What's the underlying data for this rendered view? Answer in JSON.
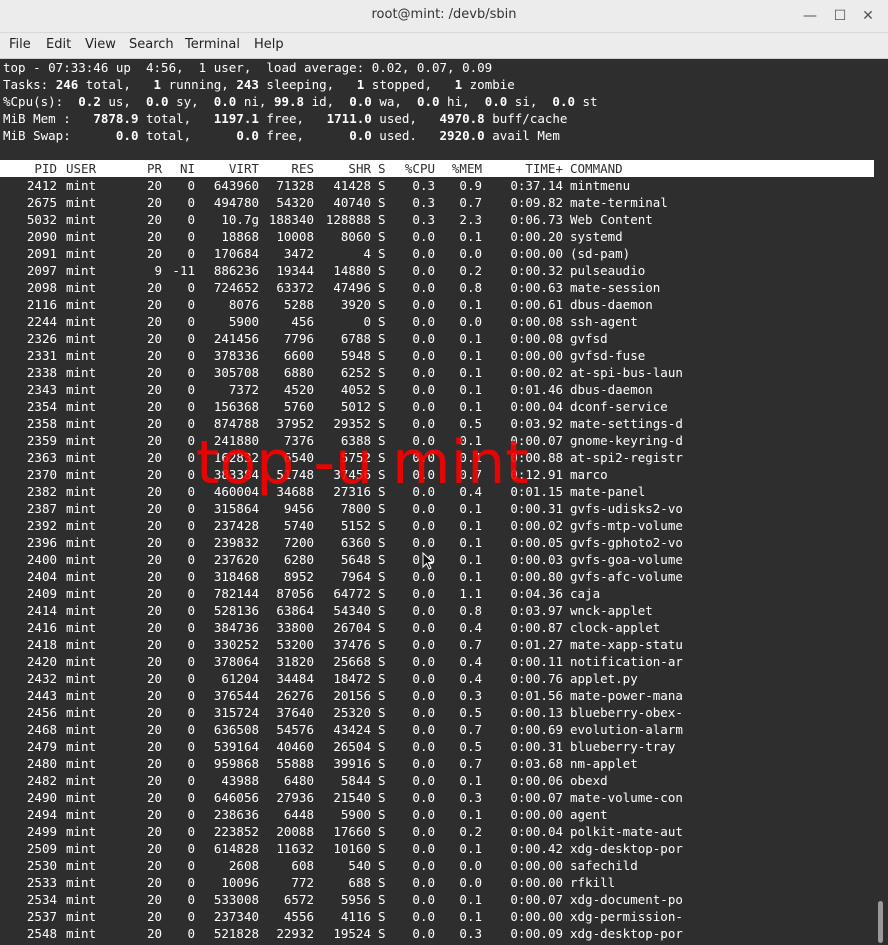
{
  "window": {
    "title": "root@mint: /devb/sbin"
  },
  "menu": [
    "File",
    "Edit",
    "View",
    "Search",
    "Terminal",
    "Help"
  ],
  "top_lines": [
    "top - 07:33:46 up  4:56,  1 user,  load average: 0.02, 0.07, 0.09",
    [
      [
        "Tasks: ",
        false
      ],
      [
        "246",
        true
      ],
      [
        " total,   ",
        false
      ],
      [
        "1",
        true
      ],
      [
        " running, ",
        false
      ],
      [
        "243",
        true
      ],
      [
        " sleeping,   ",
        false
      ],
      [
        "1",
        true
      ],
      [
        " stopped,   ",
        false
      ],
      [
        "1",
        true
      ],
      [
        " zombie",
        false
      ]
    ],
    [
      [
        "%Cpu(s):  ",
        false
      ],
      [
        "0.2",
        true
      ],
      [
        " us,  ",
        false
      ],
      [
        "0.0",
        true
      ],
      [
        " sy,  ",
        false
      ],
      [
        "0.0",
        true
      ],
      [
        " ni, ",
        false
      ],
      [
        "99.8",
        true
      ],
      [
        " id,  ",
        false
      ],
      [
        "0.0",
        true
      ],
      [
        " wa,  ",
        false
      ],
      [
        "0.0",
        true
      ],
      [
        " hi,  ",
        false
      ],
      [
        "0.0",
        true
      ],
      [
        " si,  ",
        false
      ],
      [
        "0.0",
        true
      ],
      [
        " st",
        false
      ]
    ],
    [
      [
        "MiB Mem :   ",
        false
      ],
      [
        "7878.9",
        true
      ],
      [
        " total,   ",
        false
      ],
      [
        "1197.1",
        true
      ],
      [
        " free,   ",
        false
      ],
      [
        "1711.0",
        true
      ],
      [
        " used,   ",
        false
      ],
      [
        "4970.8",
        true
      ],
      [
        " buff/cache",
        false
      ]
    ],
    [
      [
        "MiB Swap:      ",
        false
      ],
      [
        "0.0",
        true
      ],
      [
        " total,      ",
        false
      ],
      [
        "0.0",
        true
      ],
      [
        " free,      ",
        false
      ],
      [
        "0.0",
        true
      ],
      [
        " used.   ",
        false
      ],
      [
        "2920.0",
        true
      ],
      [
        " avail Mem",
        false
      ]
    ]
  ],
  "columns": [
    "PID",
    "USER",
    "PR",
    "NI",
    "VIRT",
    "RES",
    "SHR",
    "S",
    "%CPU",
    "%MEM",
    "TIME+",
    "COMMAND"
  ],
  "processes": [
    [
      "2412",
      "mint",
      "20",
      "0",
      "643960",
      "71328",
      "41428",
      "S",
      "0.3",
      "0.9",
      "0:37.14",
      "mintmenu"
    ],
    [
      "2675",
      "mint",
      "20",
      "0",
      "494780",
      "54320",
      "40740",
      "S",
      "0.3",
      "0.7",
      "0:09.82",
      "mate-terminal"
    ],
    [
      "5032",
      "mint",
      "20",
      "0",
      "10.7g",
      "188340",
      "128888",
      "S",
      "0.3",
      "2.3",
      "0:06.73",
      "Web Content"
    ],
    [
      "2090",
      "mint",
      "20",
      "0",
      "18868",
      "10008",
      "8060",
      "S",
      "0.0",
      "0.1",
      "0:00.20",
      "systemd"
    ],
    [
      "2091",
      "mint",
      "20",
      "0",
      "170684",
      "3472",
      "4",
      "S",
      "0.0",
      "0.0",
      "0:00.00",
      "(sd-pam)"
    ],
    [
      "2097",
      "mint",
      "9",
      "-11",
      "886236",
      "19344",
      "14880",
      "S",
      "0.0",
      "0.2",
      "0:00.32",
      "pulseaudio"
    ],
    [
      "2098",
      "mint",
      "20",
      "0",
      "724652",
      "63372",
      "47496",
      "S",
      "0.0",
      "0.8",
      "0:00.63",
      "mate-session"
    ],
    [
      "2116",
      "mint",
      "20",
      "0",
      "8076",
      "5288",
      "3920",
      "S",
      "0.0",
      "0.1",
      "0:00.61",
      "dbus-daemon"
    ],
    [
      "2244",
      "mint",
      "20",
      "0",
      "5900",
      "456",
      "0",
      "S",
      "0.0",
      "0.0",
      "0:00.08",
      "ssh-agent"
    ],
    [
      "2326",
      "mint",
      "20",
      "0",
      "241456",
      "7796",
      "6788",
      "S",
      "0.0",
      "0.1",
      "0:00.08",
      "gvfsd"
    ],
    [
      "2331",
      "mint",
      "20",
      "0",
      "378336",
      "6600",
      "5948",
      "S",
      "0.0",
      "0.1",
      "0:00.00",
      "gvfsd-fuse"
    ],
    [
      "2338",
      "mint",
      "20",
      "0",
      "305708",
      "6880",
      "6252",
      "S",
      "0.0",
      "0.1",
      "0:00.02",
      "at-spi-bus-laun"
    ],
    [
      "2343",
      "mint",
      "20",
      "0",
      "7372",
      "4520",
      "4052",
      "S",
      "0.0",
      "0.1",
      "0:01.46",
      "dbus-daemon"
    ],
    [
      "2354",
      "mint",
      "20",
      "0",
      "156368",
      "5760",
      "5012",
      "S",
      "0.0",
      "0.1",
      "0:00.04",
      "dconf-service"
    ],
    [
      "2358",
      "mint",
      "20",
      "0",
      "874788",
      "37952",
      "29352",
      "S",
      "0.0",
      "0.5",
      "0:03.92",
      "mate-settings-d"
    ],
    [
      "2359",
      "mint",
      "20",
      "0",
      "241880",
      "7376",
      "6388",
      "S",
      "0.0",
      "0.1",
      "0:00.07",
      "gnome-keyring-d"
    ],
    [
      "2363",
      "mint",
      "20",
      "0",
      "162832",
      "6540",
      "5752",
      "S",
      "0.0",
      "0.1",
      "0:00.88",
      "at-spi2-registr"
    ],
    [
      "2370",
      "mint",
      "20",
      "0",
      "383384",
      "51748",
      "37456",
      "S",
      "0.0",
      "0.7",
      "0:12.91",
      "marco"
    ],
    [
      "2382",
      "mint",
      "20",
      "0",
      "460004",
      "34688",
      "27316",
      "S",
      "0.0",
      "0.4",
      "0:01.15",
      "mate-panel"
    ],
    [
      "2387",
      "mint",
      "20",
      "0",
      "315864",
      "9456",
      "7800",
      "S",
      "0.0",
      "0.1",
      "0:00.31",
      "gvfs-udisks2-vo"
    ],
    [
      "2392",
      "mint",
      "20",
      "0",
      "237428",
      "5740",
      "5152",
      "S",
      "0.0",
      "0.1",
      "0:00.02",
      "gvfs-mtp-volume"
    ],
    [
      "2396",
      "mint",
      "20",
      "0",
      "239832",
      "7200",
      "6360",
      "S",
      "0.0",
      "0.1",
      "0:00.05",
      "gvfs-gphoto2-vo"
    ],
    [
      "2400",
      "mint",
      "20",
      "0",
      "237620",
      "6280",
      "5648",
      "S",
      "0.0",
      "0.1",
      "0:00.03",
      "gvfs-goa-volume"
    ],
    [
      "2404",
      "mint",
      "20",
      "0",
      "318468",
      "8952",
      "7964",
      "S",
      "0.0",
      "0.1",
      "0:00.80",
      "gvfs-afc-volume"
    ],
    [
      "2409",
      "mint",
      "20",
      "0",
      "782144",
      "87056",
      "64772",
      "S",
      "0.0",
      "1.1",
      "0:04.36",
      "caja"
    ],
    [
      "2414",
      "mint",
      "20",
      "0",
      "528136",
      "63864",
      "54340",
      "S",
      "0.0",
      "0.8",
      "0:03.97",
      "wnck-applet"
    ],
    [
      "2416",
      "mint",
      "20",
      "0",
      "384736",
      "33800",
      "26704",
      "S",
      "0.0",
      "0.4",
      "0:00.87",
      "clock-applet"
    ],
    [
      "2418",
      "mint",
      "20",
      "0",
      "330252",
      "53200",
      "37476",
      "S",
      "0.0",
      "0.7",
      "0:01.27",
      "mate-xapp-statu"
    ],
    [
      "2420",
      "mint",
      "20",
      "0",
      "378064",
      "31820",
      "25668",
      "S",
      "0.0",
      "0.4",
      "0:00.11",
      "notification-ar"
    ],
    [
      "2432",
      "mint",
      "20",
      "0",
      "61204",
      "34484",
      "18472",
      "S",
      "0.0",
      "0.4",
      "0:00.76",
      "applet.py"
    ],
    [
      "2443",
      "mint",
      "20",
      "0",
      "376544",
      "26276",
      "20156",
      "S",
      "0.0",
      "0.3",
      "0:01.56",
      "mate-power-mana"
    ],
    [
      "2456",
      "mint",
      "20",
      "0",
      "315724",
      "37640",
      "25320",
      "S",
      "0.0",
      "0.5",
      "0:00.13",
      "blueberry-obex-"
    ],
    [
      "2468",
      "mint",
      "20",
      "0",
      "636508",
      "54576",
      "43424",
      "S",
      "0.0",
      "0.7",
      "0:00.69",
      "evolution-alarm"
    ],
    [
      "2479",
      "mint",
      "20",
      "0",
      "539164",
      "40460",
      "26504",
      "S",
      "0.0",
      "0.5",
      "0:00.31",
      "blueberry-tray"
    ],
    [
      "2480",
      "mint",
      "20",
      "0",
      "959868",
      "55888",
      "39916",
      "S",
      "0.0",
      "0.7",
      "0:03.68",
      "nm-applet"
    ],
    [
      "2482",
      "mint",
      "20",
      "0",
      "43988",
      "6480",
      "5844",
      "S",
      "0.0",
      "0.1",
      "0:00.06",
      "obexd"
    ],
    [
      "2490",
      "mint",
      "20",
      "0",
      "646056",
      "27936",
      "21540",
      "S",
      "0.0",
      "0.3",
      "0:00.07",
      "mate-volume-con"
    ],
    [
      "2494",
      "mint",
      "20",
      "0",
      "238636",
      "6448",
      "5900",
      "S",
      "0.0",
      "0.1",
      "0:00.00",
      "agent"
    ],
    [
      "2499",
      "mint",
      "20",
      "0",
      "223852",
      "20088",
      "17660",
      "S",
      "0.0",
      "0.2",
      "0:00.04",
      "polkit-mate-aut"
    ],
    [
      "2509",
      "mint",
      "20",
      "0",
      "614828",
      "11632",
      "10160",
      "S",
      "0.0",
      "0.1",
      "0:00.42",
      "xdg-desktop-por"
    ],
    [
      "2530",
      "mint",
      "20",
      "0",
      "2608",
      "608",
      "540",
      "S",
      "0.0",
      "0.0",
      "0:00.00",
      "safechild"
    ],
    [
      "2533",
      "mint",
      "20",
      "0",
      "10096",
      "772",
      "688",
      "S",
      "0.0",
      "0.0",
      "0:00.00",
      "rfkill"
    ],
    [
      "2534",
      "mint",
      "20",
      "0",
      "533008",
      "6572",
      "5956",
      "S",
      "0.0",
      "0.1",
      "0:00.07",
      "xdg-document-po"
    ],
    [
      "2537",
      "mint",
      "20",
      "0",
      "237340",
      "4556",
      "4116",
      "S",
      "0.0",
      "0.1",
      "0:00.00",
      "xdg-permission-"
    ],
    [
      "2548",
      "mint",
      "20",
      "0",
      "521828",
      "22932",
      "19524",
      "S",
      "0.0",
      "0.3",
      "0:00.09",
      "xdg-desktop-por"
    ]
  ],
  "overlay_text": "top -u mint",
  "colors": {
    "terminal_bg": "#2e2e2e",
    "overlay": "#ff0000",
    "header_bg": "#ffffff"
  }
}
